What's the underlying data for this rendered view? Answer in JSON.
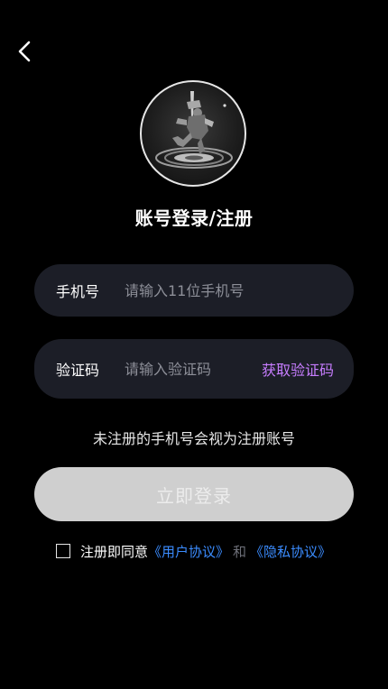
{
  "header": {
    "back_icon": "chevron-left-icon"
  },
  "profile": {
    "avatar_icon": "character-avatar"
  },
  "page_title": "账号登录/注册",
  "form": {
    "phone": {
      "label": "手机号",
      "placeholder": "请输入11位手机号",
      "value": ""
    },
    "code": {
      "label": "验证码",
      "placeholder": "请输入验证码",
      "value": "",
      "get_code_label": "获取验证码"
    }
  },
  "notice": "未注册的手机号会视为注册账号",
  "login_button": "立即登录",
  "agreement": {
    "checked": false,
    "prefix": "注册即同意",
    "user_agreement": "《用户协议》",
    "and": "和",
    "privacy_policy": "《隐私协议》"
  },
  "colors": {
    "background": "#000000",
    "field_background": "#1c1e27",
    "accent_purple": "#c77dff",
    "link_blue": "#3b8cff",
    "button_disabled": "#cfcfcf"
  }
}
